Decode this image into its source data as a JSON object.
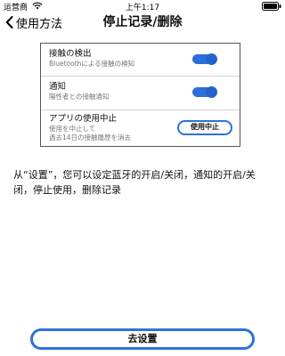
{
  "status_bar": {
    "carrier": "运营商",
    "time": "上午1:17",
    "icons": [
      "wifi-icon",
      "battery-icon"
    ]
  },
  "nav": {
    "back_label": "使用方法",
    "title": "停止记录/删除"
  },
  "settings": {
    "rows": [
      {
        "title": "接触の検出",
        "subtitle": "Bluetoothによる接触の検知",
        "toggle_on": true
      },
      {
        "title": "通知",
        "subtitle": "陽性者との接触通知",
        "toggle_on": true
      },
      {
        "title": "アプリの使用中止",
        "subtitle_line1": "使用を中止して",
        "subtitle_line2": "過去14日の接触履歴を消去",
        "button_label": "使用中止"
      }
    ]
  },
  "instruction": "从“设置”，您可以设定蓝牙的开启/关闭，通知的开启/关闭，停止使用，删除记录",
  "footer": {
    "button_label": "去设置"
  },
  "colors": {
    "accent": "#2c72dc",
    "toggle_track": "#2c6fdc"
  }
}
